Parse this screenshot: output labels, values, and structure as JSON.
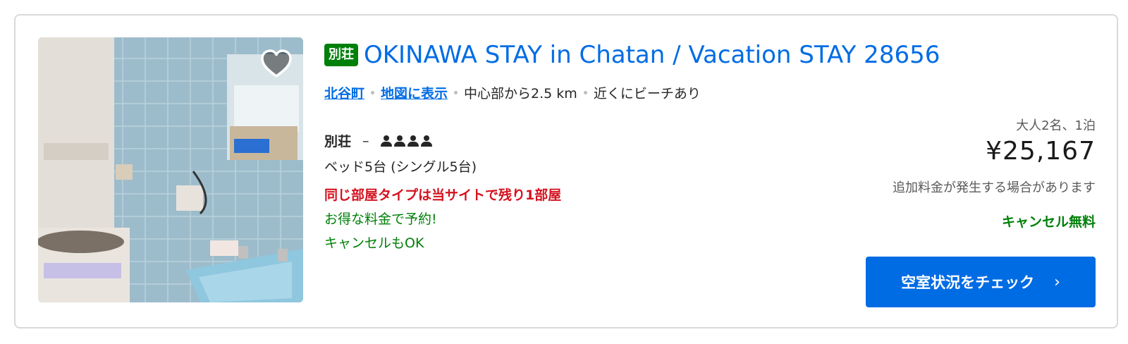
{
  "property": {
    "badge": "別荘",
    "title": "OKINAWA STAY in Chatan / Vacation STAY 28656",
    "location": {
      "town": "北谷町",
      "map_link": "地図に表示",
      "distance": "中心部から2.5 km",
      "beach": "近くにビーチあり"
    },
    "room_type": "別荘",
    "room_dash": "–",
    "max_guests": 4,
    "beds": "ベッド5台 (シングル5台)",
    "scarcity": "同じ部屋タイプは当サイトで残り1部屋",
    "deal_line1": "お得な料金で予約!",
    "deal_line2": "キャンセルもOK"
  },
  "pricing": {
    "guests_nights": "大人2名、1泊",
    "price": "¥25,167",
    "extra_fees": "追加料金が発生する場合があります",
    "free_cancel": "キャンセル無料"
  },
  "cta": {
    "label": "空室状況をチェック",
    "chevron": "›"
  },
  "icons": {
    "favorite": "heart-icon",
    "guest": "person-icon",
    "cta_arrow": "chevron-right-icon"
  },
  "colors": {
    "brand_blue": "#006ce4",
    "green": "#008009",
    "red": "#d4111e"
  }
}
